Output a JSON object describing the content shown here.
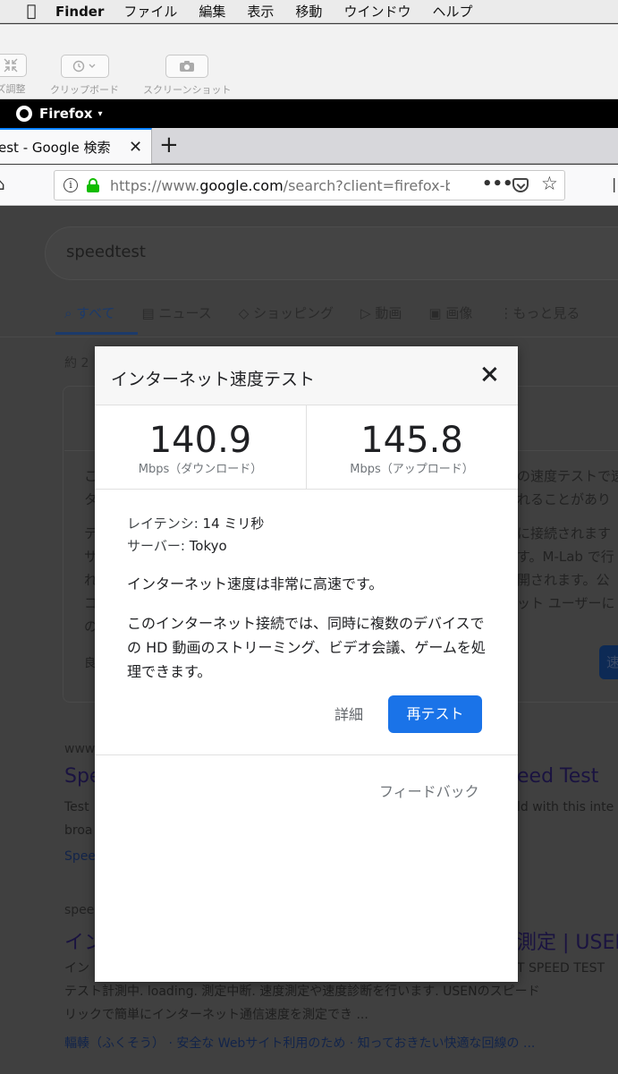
{
  "menubar": {
    "apple": "",
    "app": "Finder",
    "items": [
      "ファイル",
      "編集",
      "表示",
      "移動",
      "ウインドウ",
      "ヘルプ"
    ]
  },
  "screenshot_toolbar": {
    "tools": [
      {
        "label": "ズ調整",
        "icon": "shrink-icon"
      },
      {
        "label": "クリップボード",
        "icon": "timer-icon"
      },
      {
        "label": "スクリーンショット",
        "icon": "camera-icon"
      }
    ]
  },
  "firefox_bar": {
    "name": "Firefox",
    "caret": "▾"
  },
  "tab": {
    "title": "est - Google 検索",
    "close": "✕",
    "new_tab": "+"
  },
  "navbar": {
    "url_host_prefix": "https://www.",
    "url_host": "google.com",
    "url_rest": "/search?client=firefox-b",
    "more": "•••"
  },
  "page": {
    "search_query": "speedtest",
    "tabs": [
      "すべて",
      "ニュース",
      "ショッピング",
      "動画",
      "画像",
      "もっと見る"
    ],
    "result_count": "約 2",
    "card_snippets_left": [
      "こ",
      "タ",
      "テ",
      "サ",
      "れ",
      "コ",
      "の"
    ],
    "card_snippets_right": [
      "の速度テストで速",
      "れることがあり",
      "に接続されます",
      "す。M-Lab で行",
      "開されます。公",
      "ット ユーザーに"
    ],
    "card_footer_left": "良",
    "card_button": "速",
    "results": [
      {
        "url": "www",
        "title_left": "Spe",
        "title_right": "eed Test",
        "snippet_left": [
          "Test",
          "broa"
        ],
        "snippet_right": "ld with this inte",
        "link_left": "Spee"
      },
      {
        "url": "spee",
        "title_left": "イン",
        "title_right": "測定 | USEN",
        "snippet": [
          "イン",
          "テスト計測中. loading. 測定中断. 速度測定や速度診断を行います. USENのスピード",
          "リックで簡単にインターネット通信速度を測定でき ..."
        ],
        "snippet_right": "T SPEED TEST",
        "links": "輻輳（ふくそう） · 安全な Webサイト利用のため · 知っておきたい快適な回線の ..."
      }
    ]
  },
  "speedtest_dialog": {
    "title": "インターネット速度テスト",
    "download": {
      "value": "140.9",
      "unit": "Mbps（ダウンロード）"
    },
    "upload": {
      "value": "145.8",
      "unit": "Mbps（アップロード）"
    },
    "latency_label": "レイテンシ:",
    "latency_value": "14 ミリ秒",
    "server_label": "サーバー:",
    "server_value": "Tokyo",
    "verdict": "インターネット速度は非常に高速です。",
    "description": "このインターネット接続では、同時に複数のデバイスでの HD 動画のストリーミング、ビデオ会議、ゲームを処理できます。",
    "details_button": "詳細",
    "retest_button": "再テスト",
    "feedback": "フィードバック"
  },
  "colors": {
    "primary_button": "#1a73e8",
    "lock_green": "#12bc00",
    "overlay_dim": "#404040"
  }
}
